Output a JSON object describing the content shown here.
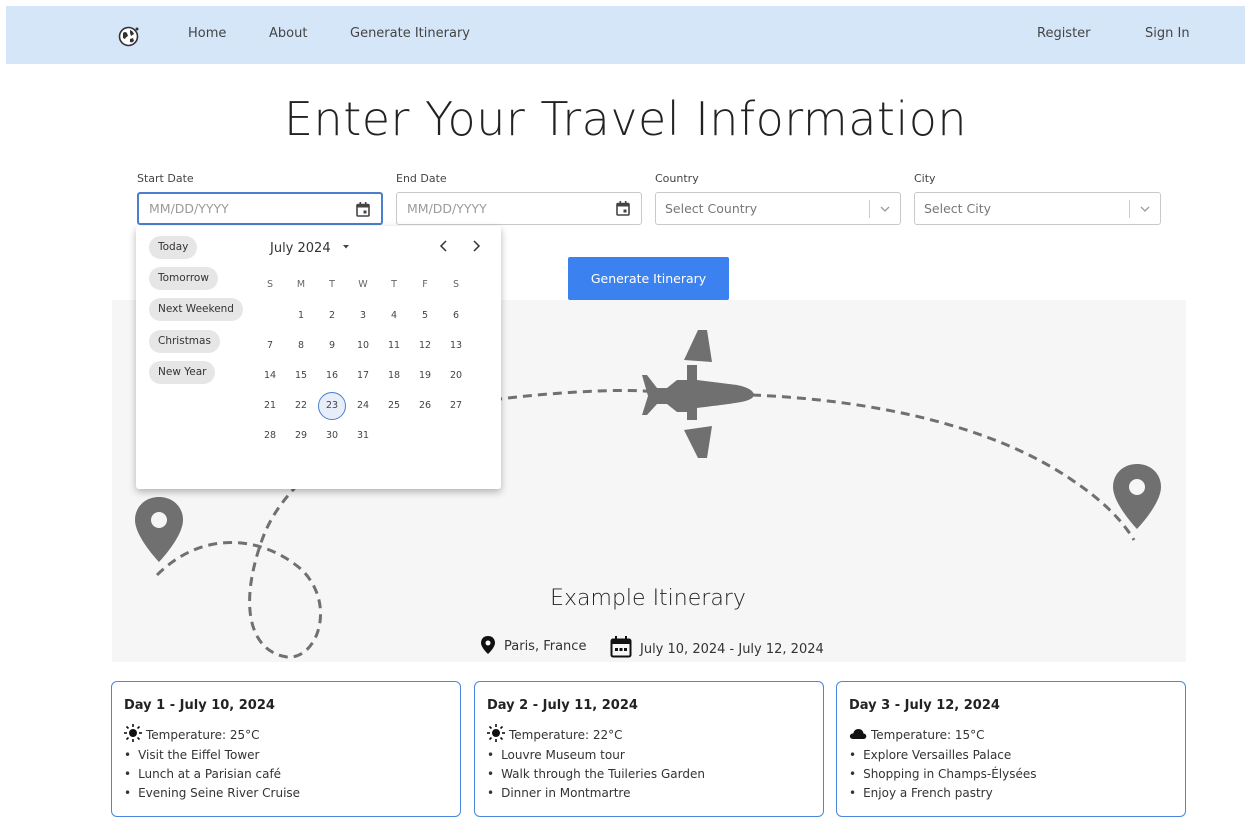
{
  "nav": {
    "home": "Home",
    "about": "About",
    "generate": "Generate Itinerary",
    "register": "Register",
    "signin": "Sign In"
  },
  "page": {
    "title": "Enter Your Travel Information"
  },
  "form": {
    "start_date": {
      "label": "Start Date",
      "placeholder": "MM/DD/YYYY"
    },
    "end_date": {
      "label": "End Date",
      "placeholder": "MM/DD/YYYY"
    },
    "country": {
      "label": "Country",
      "placeholder": "Select Country"
    },
    "city": {
      "label": "City",
      "placeholder": "Select City"
    },
    "submit_label": "Generate Itinerary"
  },
  "datepicker": {
    "shortcuts": [
      "Today",
      "Tomorrow",
      "Next Weekend",
      "Christmas",
      "New Year"
    ],
    "month_label": "July 2024",
    "weekday_headers": [
      "S",
      "M",
      "T",
      "W",
      "T",
      "F",
      "S"
    ],
    "first_weekday_index": 1,
    "days_in_month": 31,
    "selected_day": "23"
  },
  "example": {
    "title": "Example Itinerary",
    "location": "Paris, France",
    "dates": "July 10, 2024 - July 12, 2024",
    "days": [
      {
        "title": "Day 1 - July 10, 2024",
        "weather_icon": "sun-icon",
        "temperature": "Temperature: 25°C",
        "activities": [
          "Visit the Eiffel Tower",
          "Lunch at a Parisian café",
          "Evening Seine River Cruise"
        ]
      },
      {
        "title": "Day 2 - July 11, 2024",
        "weather_icon": "sun-icon",
        "temperature": "Temperature: 22°C",
        "activities": [
          "Louvre Museum tour",
          "Walk through the Tuileries Garden",
          "Dinner in Montmartre"
        ]
      },
      {
        "title": "Day 3 - July 12, 2024",
        "weather_icon": "cloud-icon",
        "temperature": "Temperature: 15°C",
        "activities": [
          "Explore Versailles Palace",
          "Shopping in Champs-Élysées",
          "Enjoy a French pastry"
        ]
      }
    ]
  },
  "colors": {
    "navbar_bg": "#d6e6f9",
    "primary_button": "#3b82f0",
    "card_border": "#4a86e0",
    "hero_bg": "#f6f6f6",
    "illustration_gray": "#707070"
  }
}
